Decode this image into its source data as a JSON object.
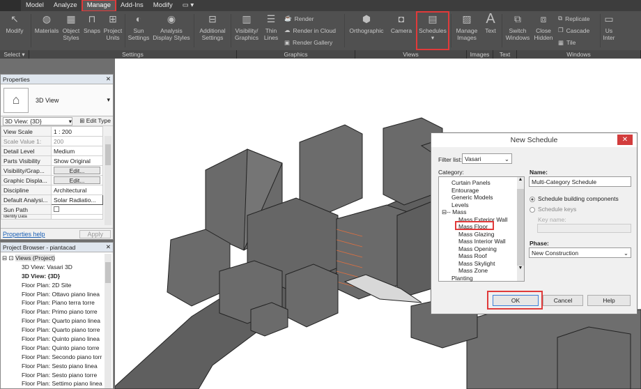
{
  "ribbon_tabs": [
    "Model",
    "Analyze",
    "Manage",
    "Add-Ins",
    "Modify"
  ],
  "ribbon": {
    "buttons": [
      {
        "label": "Modify",
        "icon": "cursor-icon"
      },
      {
        "label": "Materials",
        "icon": "materials-icon"
      },
      {
        "label": "Object\nStyles",
        "icon": "object-styles-icon"
      },
      {
        "label": "Snaps",
        "icon": "snaps-icon"
      },
      {
        "label": "Project\nUnits",
        "icon": "project-units-icon"
      },
      {
        "label": "Sun\nSettings",
        "icon": "sun-icon"
      },
      {
        "label": "Analysis\nDisplay Styles",
        "icon": "analysis-icon"
      },
      {
        "label": "Additional\nSettings",
        "icon": "settings-icon"
      },
      {
        "label": "Visibility/\nGraphics",
        "icon": "visibility-icon"
      },
      {
        "label": "Thin\nLines",
        "icon": "thin-lines-icon"
      }
    ],
    "render_items": [
      "Render",
      "Render in Cloud",
      "Render Gallery"
    ],
    "view_buttons": [
      {
        "label": "Orthographic",
        "icon": "cube-icon"
      },
      {
        "label": "Camera",
        "icon": "camera-icon"
      },
      {
        "label": "Schedules",
        "icon": "schedules-icon"
      }
    ],
    "image_buttons": [
      {
        "label": "Manage\nImages",
        "icon": "images-icon"
      }
    ],
    "text_button": {
      "label": "Text",
      "icon": "text-icon"
    },
    "window_buttons": [
      {
        "label": "Switch\nWindows",
        "icon": "switch-windows-icon"
      },
      {
        "label": "Close\nHidden",
        "icon": "close-hidden-icon"
      }
    ],
    "window_small": [
      "Replicate",
      "Cascade",
      "Tile"
    ],
    "last_label": "Us\nInter"
  },
  "panels": [
    "Select",
    "Settings",
    "Graphics",
    "Views",
    "Images",
    "Text",
    "Windows"
  ],
  "properties": {
    "title": "Properties",
    "type_name": "3D View",
    "filter": "3D View: {3D}",
    "edit_type": "Edit Type",
    "rows": [
      {
        "k": "View Scale",
        "v": "1 : 200"
      },
      {
        "k": "Scale Value    1:",
        "v": "200"
      },
      {
        "k": "Detail Level",
        "v": "Medium"
      },
      {
        "k": "Parts Visibility",
        "v": "Show Original"
      },
      {
        "k": "Visibility/Grap...",
        "v": "Edit..."
      },
      {
        "k": "Graphic Displa...",
        "v": "Edit..."
      },
      {
        "k": "Discipline",
        "v": "Architectural"
      },
      {
        "k": "Default Analysi...",
        "v": "Solar Radiatio..."
      },
      {
        "k": "Sun Path",
        "v": ""
      },
      {
        "k": "Identity Data",
        "v": ""
      }
    ],
    "help_link": "Properties help",
    "apply": "Apply"
  },
  "browser": {
    "title": "Project Browser - piantacad",
    "root": "Views (Project)",
    "items": [
      "3D View: Vasari 3D",
      "3D View: {3D}",
      "Floor Plan: 2D Site",
      "Floor Plan: Ottavo piano linea",
      "Floor Plan: Piano terra torre",
      "Floor Plan: Primo piano torre",
      "Floor Plan: Quarto piano linea",
      "Floor Plan: Quarto piano torre",
      "Floor Plan: Quinto piano linea",
      "Floor Plan: Quinto piano torre",
      "Floor Plan: Secondo piano torr",
      "Floor Plan: Sesto piano linea",
      "Floor Plan: Sesto piano torre",
      "Floor Plan: Settimo piano linea"
    ]
  },
  "dialog": {
    "title": "New Schedule",
    "filter_label": "Filter list:",
    "filter_value": "Vasari",
    "category_label": "Category:",
    "categories": [
      {
        "name": "Curtain Panels",
        "level": 1
      },
      {
        "name": "Entourage",
        "level": 1
      },
      {
        "name": "Generic Models",
        "level": 1
      },
      {
        "name": "Levels",
        "level": 1
      },
      {
        "name": "Mass",
        "level": 1
      },
      {
        "name": "Mass Exterior Wall",
        "level": 2
      },
      {
        "name": "Mass Floor",
        "level": 2
      },
      {
        "name": "Mass Glazing",
        "level": 2
      },
      {
        "name": "Mass Interior Wall",
        "level": 2
      },
      {
        "name": "Mass Opening",
        "level": 2
      },
      {
        "name": "Mass Roof",
        "level": 2
      },
      {
        "name": "Mass Skylight",
        "level": 2
      },
      {
        "name": "Mass Zone",
        "level": 2
      },
      {
        "name": "Planting",
        "level": 1
      }
    ],
    "name_label": "Name:",
    "name_value": "Multi-Category Schedule",
    "opt_components": "Schedule building components",
    "opt_keys": "Schedule keys",
    "key_name_label": "Key name:",
    "phase_label": "Phase:",
    "phase_value": "New Construction",
    "ok": "OK",
    "cancel": "Cancel",
    "help": "Help"
  },
  "colors": {
    "highlight": "#e03a3a",
    "ribbon": "#505050",
    "dialog_close": "#d23c3c"
  }
}
